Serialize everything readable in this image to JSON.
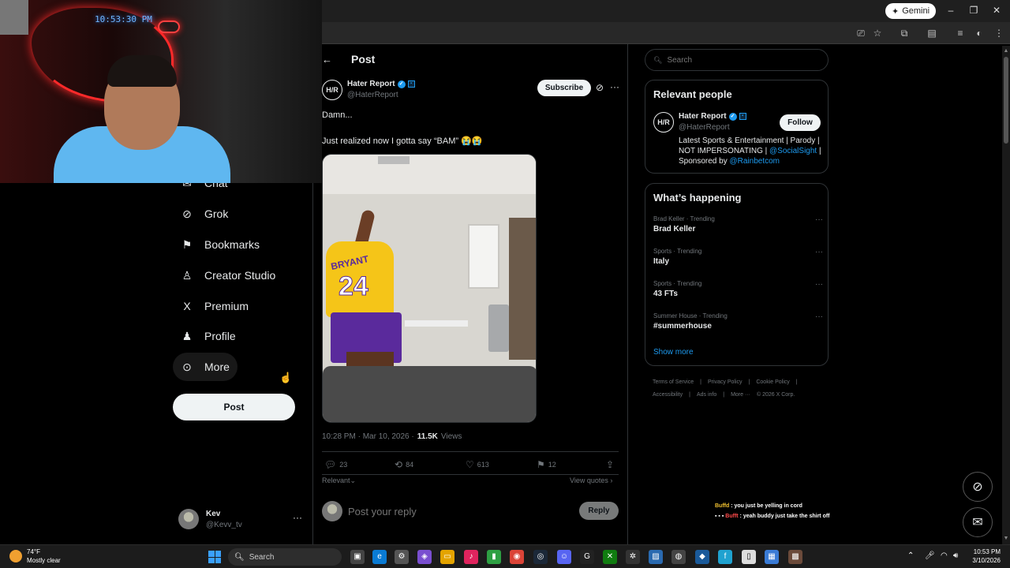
{
  "browser": {
    "gemini_label": "Gemini"
  },
  "webcam": {
    "clock_text": "10:53:30 PM"
  },
  "nav": {
    "items": [
      {
        "label": "Chat",
        "icon": "chat-icon"
      },
      {
        "label": "Grok",
        "icon": "grok-icon"
      },
      {
        "label": "Bookmarks",
        "icon": "bookmark-icon"
      },
      {
        "label": "Creator Studio",
        "icon": "creator-studio-icon"
      },
      {
        "label": "Premium",
        "icon": "x-logo-icon"
      },
      {
        "label": "Profile",
        "icon": "person-icon"
      },
      {
        "label": "More",
        "icon": "more-circle-icon"
      }
    ],
    "post_button": "Post",
    "user": {
      "name": "Kev",
      "handle": "@Kevv_tv"
    }
  },
  "post_page": {
    "header_title": "Post",
    "author": {
      "name": "Hater Report",
      "handle": "@HaterReport",
      "avatar_text": "H/R"
    },
    "subscribe_label": "Subscribe",
    "text_line1": "Damn...",
    "text_line2": "Just realized now I gotta say “BAM” 😭😭",
    "media": {
      "jersey_name": "BRYANT",
      "jersey_number": "24"
    },
    "timestamp": "10:28 PM · Mar 10, 2026 ·",
    "views_count": "11.5K",
    "views_label": "Views",
    "actions": {
      "replies": "23",
      "reposts": "84",
      "likes": "613",
      "bookmarks": "12"
    },
    "sort_label": "Relevant",
    "view_quotes": "View quotes",
    "reply_placeholder": "Post your reply",
    "reply_button": "Reply"
  },
  "sidebar": {
    "search_placeholder": "Search",
    "relevant_people": {
      "title": "Relevant people",
      "name": "Hater Report",
      "handle": "@HaterReport",
      "avatar_text": "H/R",
      "follow_label": "Follow",
      "bio_text": "Latest Sports & Entertainment | Parody | NOT IMPERSONATING | ",
      "bio_link1": "@SocialSight",
      "bio_mid": " | Sponsored by ",
      "bio_link2": "@Rainbetcom"
    },
    "whats_happening": {
      "title": "What’s happening",
      "trends": [
        {
          "meta": "Brad Keller · Trending",
          "name": "Brad Keller"
        },
        {
          "meta": "Sports · Trending",
          "name": "Italy"
        },
        {
          "meta": "Sports · Trending",
          "name": "43 FTs"
        },
        {
          "meta": "Summer House · Trending",
          "name": "#summerhouse"
        }
      ],
      "show_more": "Show more"
    },
    "footer": {
      "links": [
        "Terms of Service",
        "|",
        "Privacy Policy",
        "|",
        "Cookie Policy",
        "|",
        "Accessibility",
        "|",
        "Ads info",
        "|",
        "More ···",
        "© 2026 X Corp."
      ]
    }
  },
  "stream_chat": {
    "line1_user": "Buffd",
    "line1_text": " : you just be yelling in cord",
    "line2_user": "Bufft",
    "line2_text": " : yeah buddy just take the shirt off"
  },
  "taskbar": {
    "weather_temp": "74°F",
    "weather_desc": "Mostly clear",
    "weather_badge": "3",
    "search_label": "Search",
    "time": "10:53 PM",
    "date": "3/10/2026"
  },
  "colors": {
    "accent": "#1d9bf0",
    "background": "#000000",
    "text": "#e7e9ea",
    "muted": "#71767b",
    "border": "#2f3336"
  }
}
